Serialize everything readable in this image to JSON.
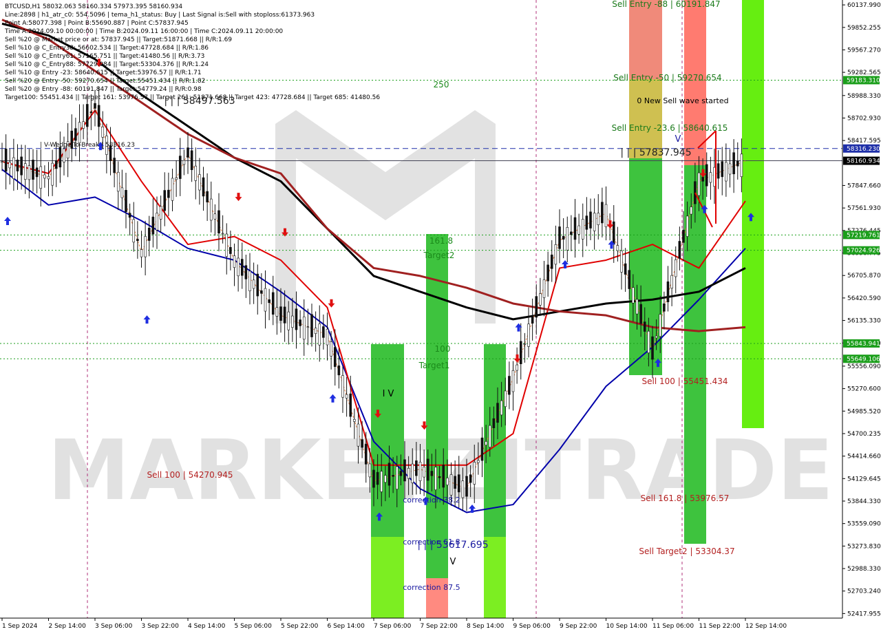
{
  "window": {
    "title": "BTCUSD,H1  58032.063 58160.334 57973.395 58160.934"
  },
  "info_panel": {
    "lines": [
      "BTCUSD,H1  58032.063 58160.334 57973.395 58160.934",
      "Line:2898  |  h1_atr_c0: 554.5096  |  tema_h1_status: Buy  |  Last Signal is:Sell with stoploss:61373.963",
      "Point A:58077.398  |  Point B:55690.887  |  Point C:57837.945",
      "Time A:2024.09.10 00:00:00  |  Time B:2024.09.11 16:00:00  |  Time C:2024.09.11 20:00:00",
      "Sell %20 @ Market price or at: 57837.945  ||  Target:51871.668  ||  R/R:1.69",
      "Sell %10 @ C_Entry38: 56602.534  ||  Target:47728.684  ||  R/R:1.86",
      "Sell %10 @ C_Entry61: 57165.751  ||  Target:41480.56  ||  R/R:3.73",
      "Sell %10 @ C_Entry88: 57729.084  ||  Target:53304.376  ||  R/R:1.24",
      "Sell %10 @ Entry -23: 58640.615  ||  Target:53976.57  ||  R/R:1.71",
      "Sell %20 @ Entry -50: 59270.654  ||  Target:55451.434  ||  R/R:1.82",
      "Sell %20 @ Entry -88: 60191.847  ||  Target:54779.24  ||  R/R:0.98",
      "Target100: 55451.434  ||  Target 161: 53976.57  ||  Target 261: 51871.668  ||  Target 423: 47728.684  ||  Target 685: 41480.56"
    ]
  },
  "watermark": {
    "text": "MARKETZITRADE"
  },
  "price_axis": {
    "ticks": [
      "60137.990",
      "59852.255",
      "59567.270",
      "59282.565",
      "58988.330",
      "58702.930",
      "58417.595",
      "57847.660",
      "57561.930",
      "57276.445",
      "56990.775",
      "56705.870",
      "56420.590",
      "56135.330",
      "55849.600",
      "55556.090",
      "55270.600",
      "54985.520",
      "54700.235",
      "54414.660",
      "54129.645",
      "53844.330",
      "53559.090",
      "53273.830",
      "52988.330",
      "52703.240",
      "52417.955"
    ],
    "tick_values": [
      60137.99,
      59852.255,
      59567.27,
      59282.565,
      58988.33,
      58702.93,
      58417.595,
      57847.66,
      57561.93,
      57276.445,
      56990.775,
      56705.87,
      56420.59,
      56135.33,
      55849.6,
      55556.09,
      55270.6,
      54985.52,
      54700.235,
      54414.66,
      54129.645,
      53844.33,
      53559.09,
      53273.83,
      52988.33,
      52703.24,
      52417.955
    ],
    "badges": [
      {
        "label": "59183.310",
        "value": 59183.31,
        "color": "#1a9e1a"
      },
      {
        "label": "58316.230",
        "value": 58316.23,
        "color": "#1e2fa8"
      },
      {
        "label": "58160.934",
        "value": 58160.934,
        "color": "#000000"
      },
      {
        "label": "57219.761",
        "value": 57219.761,
        "color": "#1a9e1a"
      },
      {
        "label": "57024.926",
        "value": 57024.926,
        "color": "#1a9e1a"
      },
      {
        "label": "55843.941",
        "value": 55843.941,
        "color": "#1a9e1a"
      },
      {
        "label": "55649.106",
        "value": 55649.106,
        "color": "#1a9e1a"
      }
    ]
  },
  "time_axis": {
    "ticks": [
      "1 Sep 2024",
      "2 Sep 14:00",
      "3 Sep 06:00",
      "3 Sep 22:00",
      "4 Sep 14:00",
      "5 Sep 06:00",
      "5 Sep 22:00",
      "6 Sep 14:00",
      "7 Sep 06:00",
      "7 Sep 22:00",
      "8 Sep 14:00",
      "9 Sep 06:00",
      "9 Sep 22:00",
      "10 Sep 14:00",
      "11 Sep 06:00",
      "11 Sep 22:00",
      "12 Sep 14:00"
    ]
  },
  "chart_labels": {
    "level_250": "250",
    "level_161": "161.8",
    "target2": "Target2",
    "level_100": "100",
    "target1": "Target1",
    "sell_entry_88": "Sell Entry -88 | 60191.847",
    "sell_entry_50": "Sell Entry -50 | 59270.654",
    "new_sell_wave": "0 New Sell wave started",
    "sell_entry_23": "Sell Entry -23.6 | 58640.615",
    "point_c": "| | | 57837.945",
    "point_a": "| | | 58497.563",
    "wedge_break": "| V-Wedge-To-Break  |  58316.23",
    "sell_100_right": "Sell 100 | 55451.434",
    "sell_161_right": "Sell 161.8 | 53976.57",
    "sell_target2": "Sell Target2 | 53304.37",
    "sell_100_left": "Sell 100 | 54270.945",
    "correction_38": "correction 38.2",
    "correction_61": "correction 61.8",
    "correction_87": "correction 87.5",
    "point_b": "| | | 53617.695",
    "wave_iv": "I V",
    "wave_v": "V",
    "wave_iv_right": "V"
  },
  "chart_data": {
    "type": "line",
    "title": "BTCUSD,H1",
    "xlabel": "",
    "ylabel": "",
    "x": [
      "1 Sep 2024",
      "2 Sep 14:00",
      "3 Sep 06:00",
      "3 Sep 22:00",
      "4 Sep 14:00",
      "5 Sep 06:00",
      "5 Sep 22:00",
      "6 Sep 14:00",
      "7 Sep 06:00",
      "7 Sep 22:00",
      "8 Sep 14:00",
      "9 Sep 06:00",
      "9 Sep 22:00",
      "10 Sep 14:00",
      "11 Sep 06:00",
      "11 Sep 22:00",
      "12 Sep 14:00"
    ],
    "ylim": [
      52360,
      60200
    ],
    "grid": false,
    "series": [
      {
        "color": "#0000aa",
        "values": [
          58050,
          57600,
          57700,
          57400,
          57050,
          56900,
          56500,
          56050,
          54600,
          54000,
          53700,
          53800,
          54500,
          55300,
          55800,
          56400,
          57050
        ]
      },
      {
        "color": "#e00000",
        "values": [
          58150,
          58000,
          58800,
          57900,
          57100,
          57200,
          56900,
          56300,
          54300,
          54300,
          54300,
          54700,
          56800,
          56900,
          57100,
          56800,
          57650
        ]
      },
      {
        "color": "#000000",
        "values": [
          59900,
          59750,
          59450,
          59000,
          58600,
          58200,
          57900,
          57300,
          56700,
          56500,
          56300,
          56150,
          56250,
          56350,
          56400,
          56500,
          56800
        ]
      },
      {
        "color": "#a02020",
        "values": [
          59950,
          59700,
          59300,
          58900,
          58500,
          58200,
          58000,
          57300,
          56800,
          56700,
          56550,
          56350,
          56250,
          56200,
          56050,
          56000,
          56050
        ]
      }
    ],
    "price_points": [
      [
        "1 Sep 2024",
        58150
      ],
      [
        "2 Sep 14:00",
        57950
      ],
      [
        "3 Sep 06:00",
        58850
      ],
      [
        "3 Sep 22:00",
        57000
      ],
      [
        "4 Sep 14:00",
        58250
      ],
      [
        "5 Sep 06:00",
        56900
      ],
      [
        "5 Sep 22:00",
        56200
      ],
      [
        "6 Sep 14:00",
        55950
      ],
      [
        "7 Sep 06:00",
        54100
      ],
      [
        "7 Sep 22:00",
        54250
      ],
      [
        "8 Sep 14:00",
        54000
      ],
      [
        "9 Sep 06:00",
        55400
      ],
      [
        "9 Sep 22:00",
        57150
      ],
      [
        "10 Sep 14:00",
        57500
      ],
      [
        "11 Sep 06:00",
        55750
      ],
      [
        "11 Sep 22:00",
        57900
      ],
      [
        "12 Sep 14:00",
        58160
      ]
    ]
  }
}
